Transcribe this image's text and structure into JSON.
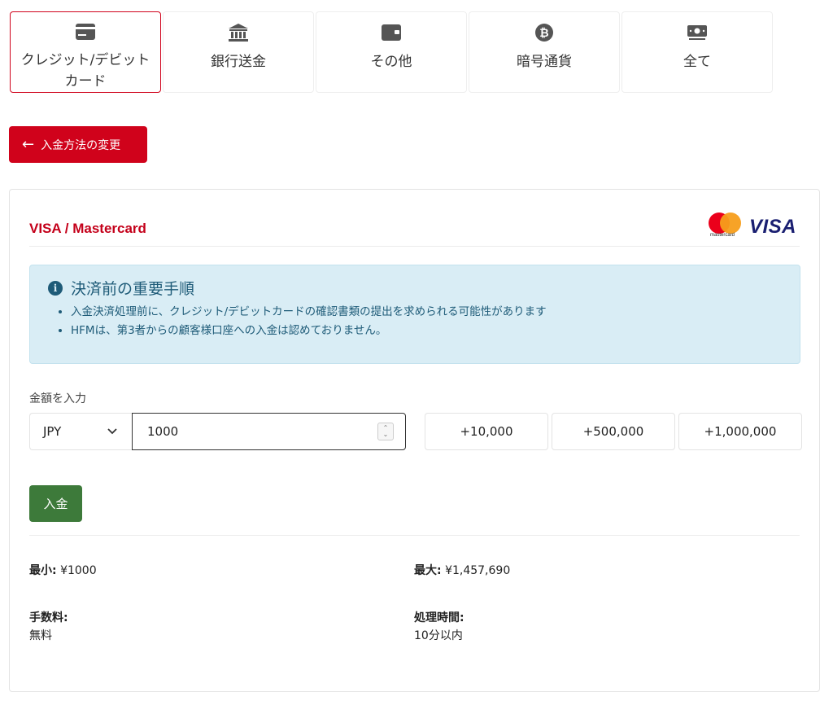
{
  "tabs": [
    {
      "label": "クレジット/デビットカード",
      "icon": "credit-card-icon",
      "active": true
    },
    {
      "label": "銀行送金",
      "icon": "bank-icon",
      "active": false
    },
    {
      "label": "その他",
      "icon": "wallet-icon",
      "active": false
    },
    {
      "label": "暗号通貨",
      "icon": "bitcoin-icon",
      "active": false
    },
    {
      "label": "全て",
      "icon": "money-icon",
      "active": false
    }
  ],
  "back_button": {
    "label": "入金方法の変更",
    "icon": "arrow-left-icon"
  },
  "card": {
    "title": "VISA / Mastercard",
    "brand_mastercard": "mastercard",
    "brand_visa": "VISA"
  },
  "notice": {
    "title": "決済前の重要手順",
    "items": [
      "入金決済処理前に、クレジット/デビットカードの確認書類の提出を求められる可能性があります",
      "HFMは、第3者からの顧客様口座への入金は認めておりません。"
    ]
  },
  "amount": {
    "label": "金額を入力",
    "currency": "JPY",
    "value": "1000",
    "presets": [
      "+10,000",
      "+500,000",
      "+1,000,000"
    ]
  },
  "deposit_button": {
    "label": "入金"
  },
  "limits": {
    "min_label": "最小:",
    "min_value": "¥1000",
    "max_label": "最大:",
    "max_value": "¥1,457,690",
    "fee_label": "手数料:",
    "fee_value": "無料",
    "time_label": "処理時間:",
    "time_value": "10分以内"
  },
  "colors": {
    "accent": "#d0021b",
    "deposit": "#3d7a3a",
    "notice_bg": "#d9edf5",
    "notice_text": "#1e5b78"
  }
}
